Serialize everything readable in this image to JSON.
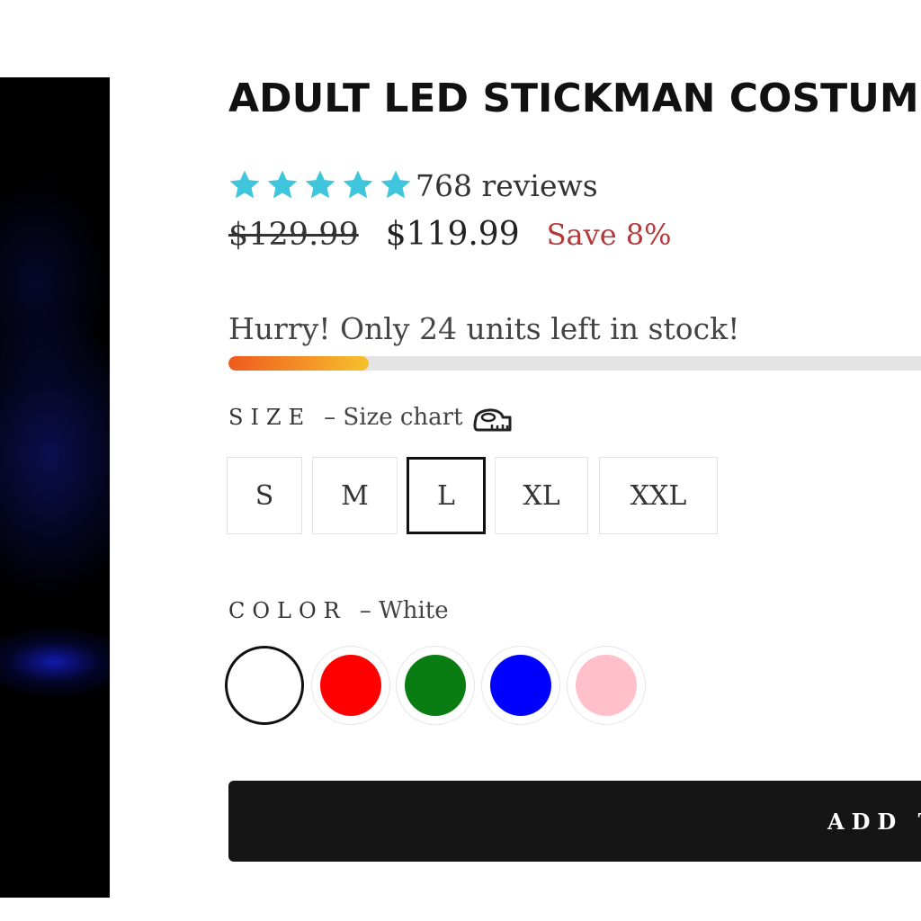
{
  "product": {
    "title": "ADULT LED STICKMAN COSTUM",
    "image_alt": "product-photo"
  },
  "rating": {
    "stars": 5,
    "star_color": "#3fc6dc",
    "reviews_label": "768 reviews"
  },
  "pricing": {
    "original_price": "$129.99",
    "sale_price": "$119.99",
    "save_label": "Save 8%",
    "save_color": "#b33a3a"
  },
  "stock": {
    "message": "Hurry! Only 24 units left in stock!",
    "progress_fraction": 0.2
  },
  "size": {
    "label": "SIZE",
    "size_chart_link": "– Size chart",
    "options": [
      "S",
      "M",
      "L",
      "XL",
      "XXL"
    ],
    "selected": "L"
  },
  "color": {
    "label": "COLOR",
    "selected_name": "– White",
    "swatches": [
      {
        "name": "White",
        "hex": "#ffffff",
        "selected": true
      },
      {
        "name": "Red",
        "hex": "#ff0000",
        "selected": false
      },
      {
        "name": "Green",
        "hex": "#0a7d12",
        "selected": false
      },
      {
        "name": "Blue",
        "hex": "#0000ff",
        "selected": false
      },
      {
        "name": "Pink",
        "hex": "#ffbfcb",
        "selected": false
      }
    ]
  },
  "cart": {
    "button_label": "ADD T"
  }
}
